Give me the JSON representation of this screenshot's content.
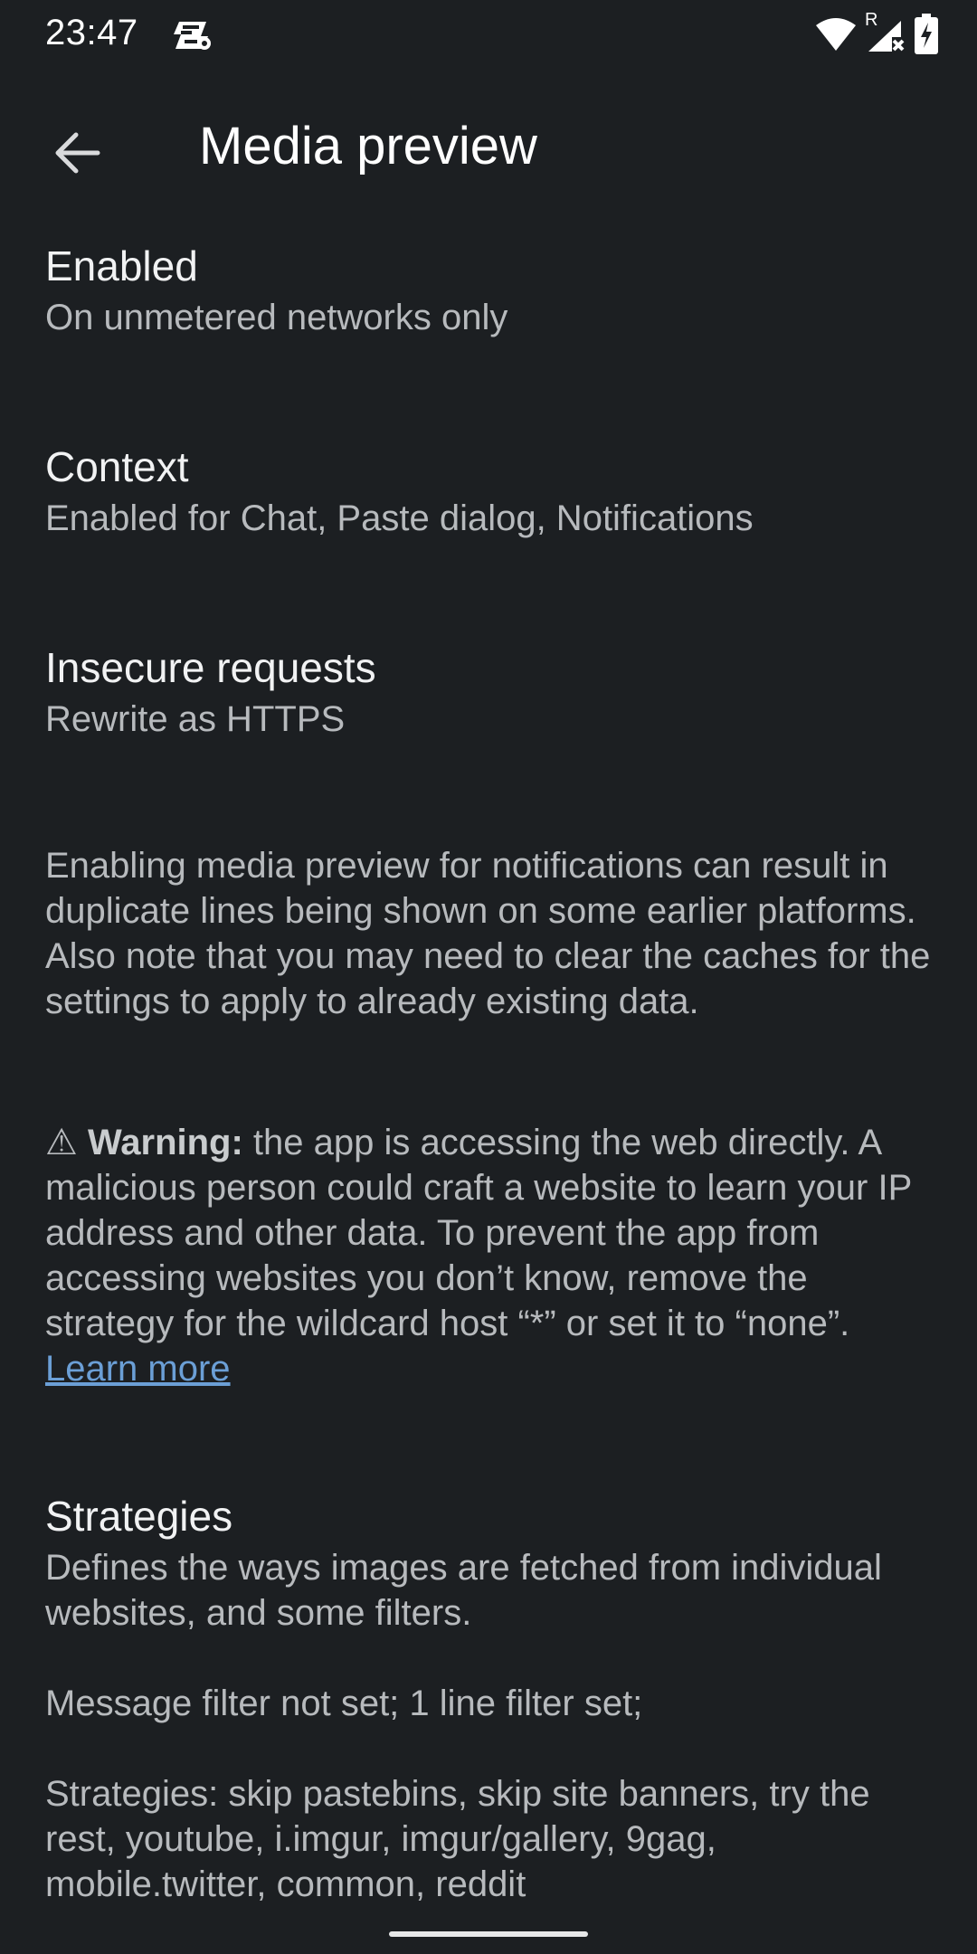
{
  "status_bar": {
    "time": "23:47",
    "notification_icon": "app-notification-icon",
    "network_badge": "R",
    "icons": [
      "wifi-icon",
      "cellular-signal-icon",
      "battery-charging-icon"
    ]
  },
  "app_bar": {
    "back_icon": "arrow-back-icon",
    "title": "Media preview"
  },
  "preferences": {
    "enabled": {
      "title": "Enabled",
      "summary": "On unmetered networks only"
    },
    "context": {
      "title": "Context",
      "summary": "Enabled for Chat, Paste dialog, Notifications"
    },
    "insecure": {
      "title": "Insecure requests",
      "summary": "Rewrite as HTTPS"
    }
  },
  "info": {
    "notice": "Enabling media preview for notifications can result in duplicate lines being shown on some earlier platforms. Also note that you may need to clear the caches for the settings to apply to already existing data.",
    "warning_symbol": "⚠",
    "warning_label": "Warning:",
    "warning_text": " the app is accessing the web directly. A malicious person could craft a website to learn your IP address and other data. To prevent the app from accessing websites you don’t know, remove the strategy for the wildcard host “*” or set it to “none”. ",
    "learn_more": "Learn more"
  },
  "strategies": {
    "title": "Strategies",
    "description": "Defines the ways images are fetched from individual websites, and some filters.",
    "filters": "Message filter not set; 1 line filter set;",
    "list": "Strategies: skip pastebins, skip site banners, try the rest, youtube, i.imgur, imgur/gallery, 9gag, mobile.twitter, common, reddit"
  }
}
